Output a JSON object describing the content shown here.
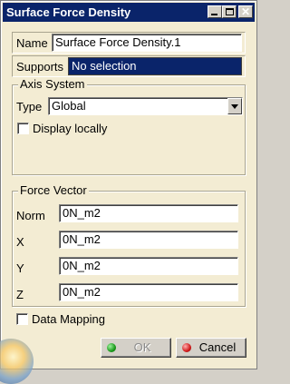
{
  "window": {
    "title": "Surface Force Density"
  },
  "name_row": {
    "label": "Name",
    "value": "Surface Force Density.1"
  },
  "supports_row": {
    "label": "Supports",
    "value": "No selection"
  },
  "axis_system": {
    "title": "Axis System",
    "type_label": "Type",
    "type_value": "Global",
    "display_locally_label": "Display locally",
    "display_locally_checked": false
  },
  "force_vector": {
    "title": "Force Vector",
    "rows": [
      {
        "label": "Norm",
        "value": "0N_m2"
      },
      {
        "label": "X",
        "value": "0N_m2"
      },
      {
        "label": "Y",
        "value": "0N_m2"
      },
      {
        "label": "Z",
        "value": "0N_m2"
      }
    ]
  },
  "data_mapping": {
    "label": "Data Mapping",
    "checked": false
  },
  "buttons": {
    "ok_label": "OK",
    "cancel_label": "Cancel",
    "ok_color": "#1a9a1a",
    "cancel_color": "#d01a1a"
  }
}
